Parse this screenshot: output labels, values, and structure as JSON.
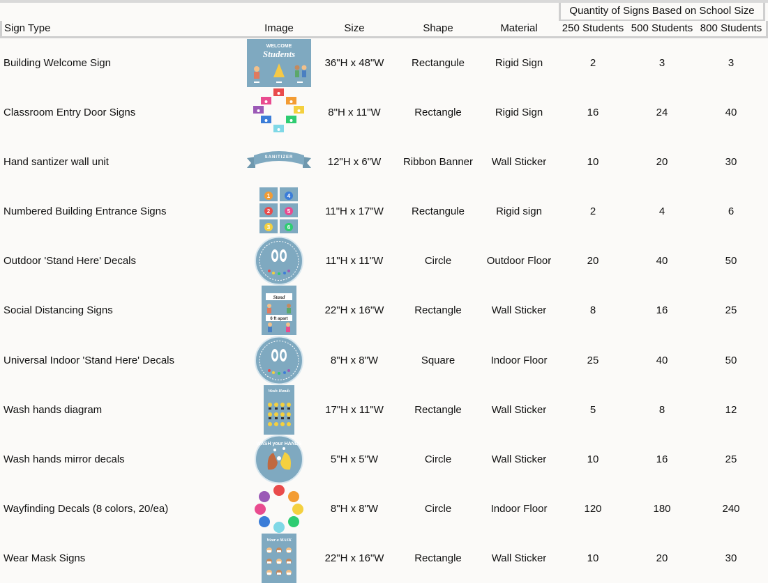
{
  "header": {
    "group_title": "Quantity of Signs Based on School Size",
    "columns": {
      "type": "Sign Type",
      "image": "Image",
      "size": "Size",
      "shape": "Shape",
      "material": "Material",
      "q1": "250 Students",
      "q2": "500 Students",
      "q3": "800 Students"
    }
  },
  "rows": [
    {
      "type": "Building Welcome Sign",
      "size": "36\"H x 48\"W",
      "shape": "Rectangule",
      "material": "Rigid Sign",
      "q1": "2",
      "q2": "3",
      "q3": "3",
      "icon": "welcome-students-sign-icon"
    },
    {
      "type": "Classroom Entry Door Signs",
      "size": "8\"H x 11\"W",
      "shape": "Rectangle",
      "material": "Rigid Sign",
      "q1": "16",
      "q2": "24",
      "q3": "40",
      "icon": "colored-door-signs-icon"
    },
    {
      "type": "Hand santizer wall unit",
      "size": "12\"H x 6\"W",
      "shape": "Ribbon Banner",
      "material": "Wall Sticker",
      "q1": "10",
      "q2": "20",
      "q3": "30",
      "icon": "ribbon-banner-icon"
    },
    {
      "type": "Numbered Building Entrance Signs",
      "size": "11\"H x 17\"W",
      "shape": "Rectangule",
      "material": "Rigid sign",
      "q1": "2",
      "q2": "4",
      "q3": "6",
      "icon": "numbered-signs-icon"
    },
    {
      "type": "Outdoor 'Stand Here' Decals",
      "size": "11\"H x 11\"W",
      "shape": "Circle",
      "material": "Outdoor Floor",
      "q1": "20",
      "q2": "40",
      "q3": "50",
      "icon": "footprints-decal-icon"
    },
    {
      "type": "Social Distancing Signs",
      "size": "22\"H x 16\"W",
      "shape": "Rectangle",
      "material": "Wall Sticker",
      "q1": "8",
      "q2": "16",
      "q3": "25",
      "icon": "social-distancing-sign-icon"
    },
    {
      "type": "Universal Indoor 'Stand Here' Decals",
      "size": "8\"H x 8\"W",
      "shape": "Square",
      "material": "Indoor Floor",
      "q1": "25",
      "q2": "40",
      "q3": "50",
      "icon": "footprints-decal-icon"
    },
    {
      "type": "Wash hands diagram",
      "size": "17\"H x 11\"W",
      "shape": "Rectangle",
      "material": "Wall Sticker",
      "q1": "5",
      "q2": "8",
      "q3": "12",
      "icon": "wash-hands-diagram-icon"
    },
    {
      "type": "Wash hands mirror decals",
      "size": "5\"H x 5\"W",
      "shape": "Circle",
      "material": "Wall Sticker",
      "q1": "10",
      "q2": "16",
      "q3": "25",
      "icon": "wash-hands-decal-icon"
    },
    {
      "type": "Wayfinding Decals (8 colors, 20/ea)",
      "size": "8\"H x 8\"W",
      "shape": "Circle",
      "material": "Indoor Floor",
      "q1": "120",
      "q2": "180",
      "q3": "240",
      "icon": "colored-circles-icon"
    },
    {
      "type": "Wear Mask Signs",
      "size": "22\"H x 16\"W",
      "shape": "Rectangle",
      "material": "Wall Sticker",
      "q1": "10",
      "q2": "20",
      "q3": "30",
      "icon": "wear-mask-sign-icon"
    }
  ],
  "colors": {
    "sign_blue": "#7fa9c0",
    "border": "#cfcfcf",
    "background": "#fbfaf8"
  },
  "image_text": {
    "welcome": "Students",
    "stand": "Stand",
    "apart": "6 ft apart",
    "wash": "Wash Hands",
    "wear": "Wear a MASK",
    "wash_round": "WASH your HANDS"
  }
}
